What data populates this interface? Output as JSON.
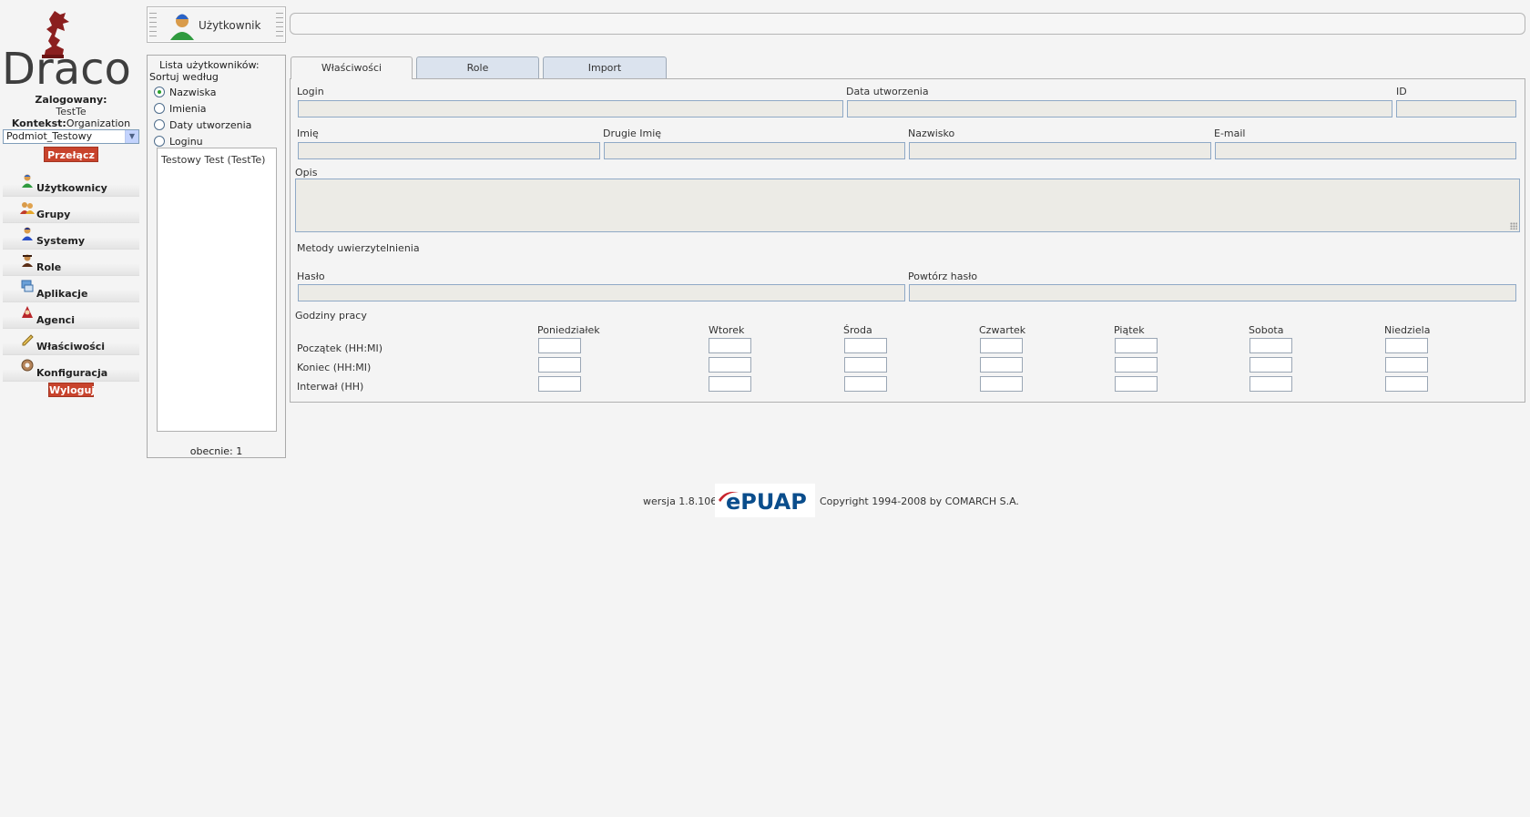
{
  "app": {
    "logo_text": "Draco"
  },
  "session": {
    "logged_label": "Zalogowany:",
    "user": "TestTe",
    "context_label": "Kontekst:",
    "context_value": "Organization",
    "entity_select_value": "Podmiot_Testowy",
    "switch_label": "Przełącz",
    "logout_label": "Wyloguj"
  },
  "nav": [
    {
      "label": "Użytkownicy",
      "icon": "user-icon"
    },
    {
      "label": "Grupy",
      "icon": "group-icon"
    },
    {
      "label": "Systemy",
      "icon": "system-icon"
    },
    {
      "label": "Role",
      "icon": "role-icon"
    },
    {
      "label": "Aplikacje",
      "icon": "application-icon"
    },
    {
      "label": "Agenci",
      "icon": "agent-icon"
    },
    {
      "label": "Właściwości",
      "icon": "properties-icon"
    },
    {
      "label": "Konfiguracja",
      "icon": "configuration-icon"
    }
  ],
  "header": {
    "title": "Użytkownik",
    "search_value": ""
  },
  "user_list": {
    "title": "Lista użytkowników:",
    "sort_label": "Sortuj według",
    "sort_options": [
      {
        "label": "Nazwiska",
        "checked": true
      },
      {
        "label": "Imienia",
        "checked": false
      },
      {
        "label": "Daty utworzenia",
        "checked": false
      },
      {
        "label": "Loginu",
        "checked": false
      }
    ],
    "items": [
      "Testowy Test (TestTe)"
    ],
    "count_label": "obecnie: 1"
  },
  "tabs": [
    "Właściwości",
    "Role",
    "Import"
  ],
  "form": {
    "login_label": "Login",
    "created_label": "Data utworzenia",
    "id_label": "ID",
    "first_name_label": "Imię",
    "middle_name_label": "Drugie Imię",
    "last_name_label": "Nazwisko",
    "email_label": "E-mail",
    "description_label": "Opis",
    "auth_methods_label": "Metody uwierzytelnienia",
    "password_label": "Hasło",
    "repeat_password_label": "Powtórz hasło",
    "work_hours_label": "Godziny pracy",
    "days": [
      "Poniedziałek",
      "Wtorek",
      "Środa",
      "Czwartek",
      "Piątek",
      "Sobota",
      "Niedziela"
    ],
    "rows": [
      "Początek (HH:MI)",
      "Koniec (HH:MI)",
      "Interwał (HH)"
    ]
  },
  "footer": {
    "version": "wersja 1.8.106",
    "logo_alt": "ePUAP",
    "copyright": "Copyright 1994-2008 by COMARCH S.A."
  },
  "colors": {
    "button_red": "#c8432c",
    "tab_blue": "#dbe3ee",
    "field_bg": "#ecebe6",
    "field_border": "#8fa9c6"
  }
}
